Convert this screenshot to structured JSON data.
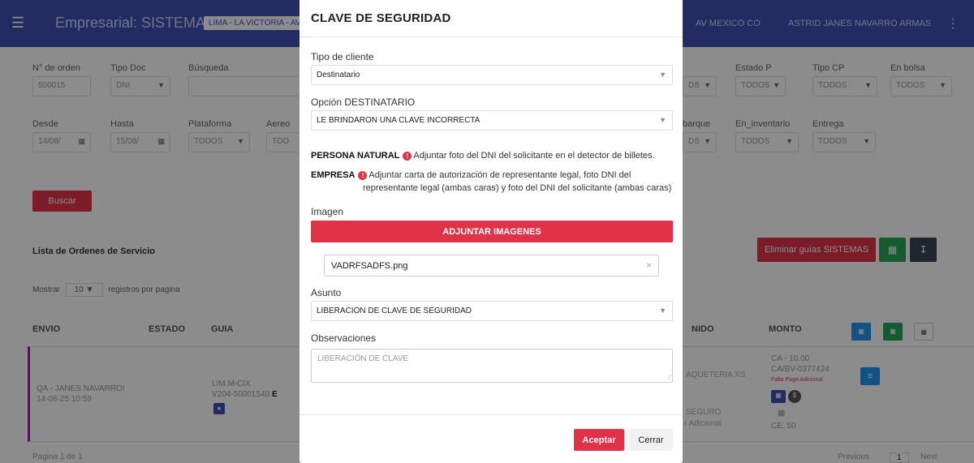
{
  "topbar": {
    "brand": "Empresarial: SISTEMAS",
    "location": "LIMA - LA VICTORIA - AV",
    "company": "AV MEXICO CO",
    "user": "ASTRID JANES NAVARRO ARMAS"
  },
  "filters": {
    "orden": {
      "label": "N° de orden",
      "value": "500015"
    },
    "tipo_doc": {
      "label": "Tipo Doc",
      "value": "DNI"
    },
    "busqueda": {
      "label": "Búsqueda",
      "value": ""
    },
    "estado_p": {
      "label": "Estado P",
      "value": "TODOS"
    },
    "tipo_cp": {
      "label": "Tipo CP",
      "value": "TODOS"
    },
    "en_bolsa": {
      "label": "En bolsa",
      "value": "TODOS"
    },
    "hidden_sel1": {
      "value": "DS"
    },
    "desde": {
      "label": "Desde",
      "value": "14/08/"
    },
    "hasta": {
      "label": "Hasta",
      "value": "15/08/"
    },
    "plataforma": {
      "label": "Plataforma",
      "value": "TODOS"
    },
    "aereo": {
      "label": "Aereo",
      "value": "TOD"
    },
    "embarque": {
      "label": "barque",
      "value": "DS"
    },
    "en_inventario": {
      "label": "En_inventario",
      "value": "TODOS"
    },
    "entrega": {
      "label": "Entrega",
      "value": "TODOS"
    },
    "buscar_label": "Buscar"
  },
  "list": {
    "title": "Lista de Ordenes de Servicio",
    "delete_label": "Eliminar guías SISTEMAS",
    "show_prefix": "Mostrar",
    "show_value": "10",
    "show_suffix": "registros por pagina",
    "headers": {
      "envio": "ENVIO",
      "estado": "ESTADO",
      "guia": "GUIA",
      "nido": "NIDO",
      "monto": "MONTO"
    },
    "row": {
      "envio_name": "QA - JANES NAVARRO!",
      "envio_date": "14-08-25 10:59",
      "guia_line1": "LIM.M-CIX",
      "guia_line2": "V204-50001540",
      "guia_tag": "E",
      "nido_line1": "AQUETERIA XS",
      "nido_line2": "SEGURO",
      "nido_line3": "r Adicional",
      "monto_line1": "CA - 10.00",
      "monto_line2": "CA/BV-0377424",
      "monto_note": "Falta Pago Adicional",
      "monto_ce": "CE: 50"
    },
    "footer_left": "Pagina 1 de 1",
    "prev": "Previous",
    "page": "1",
    "next": "Next"
  },
  "modal": {
    "title": "CLAVE DE SEGURIDAD",
    "tipo_cliente_label": "Tipo de cliente",
    "tipo_cliente_value": "Destinatario",
    "opcion_label": "Opción DESTINATARIO",
    "opcion_value": "LE BRINDARON UNA CLAVE INCORRECTA",
    "persona_title": "PERSONA NATURAL",
    "persona_text": "Adjuntar foto del DNI del solicitante en el detector de billetes.",
    "empresa_title": "EMPRESA",
    "empresa_text1": "Adjuntar carta de autorización de representante legal, foto DNI del",
    "empresa_text2": "representante legal (ambas caras) y foto del DNI del solicitante (ambas caras)",
    "imagen_label": "Imagen",
    "attach_label": "ADJUNTAR IMAGENES",
    "file_name": "VADRFSADFS.png",
    "asunto_label": "Asunto",
    "asunto_value": "LIBERACION DE CLAVE DE SEGURIDAD",
    "obs_label": "Observaciones",
    "obs_value": "LIBERACIÓN DE CLAVE",
    "ok_label": "Aceptar",
    "close_label": "Cerrar"
  },
  "colors": {
    "primary": "#3f51b5",
    "danger": "#e0334a",
    "success": "#26a65b"
  }
}
